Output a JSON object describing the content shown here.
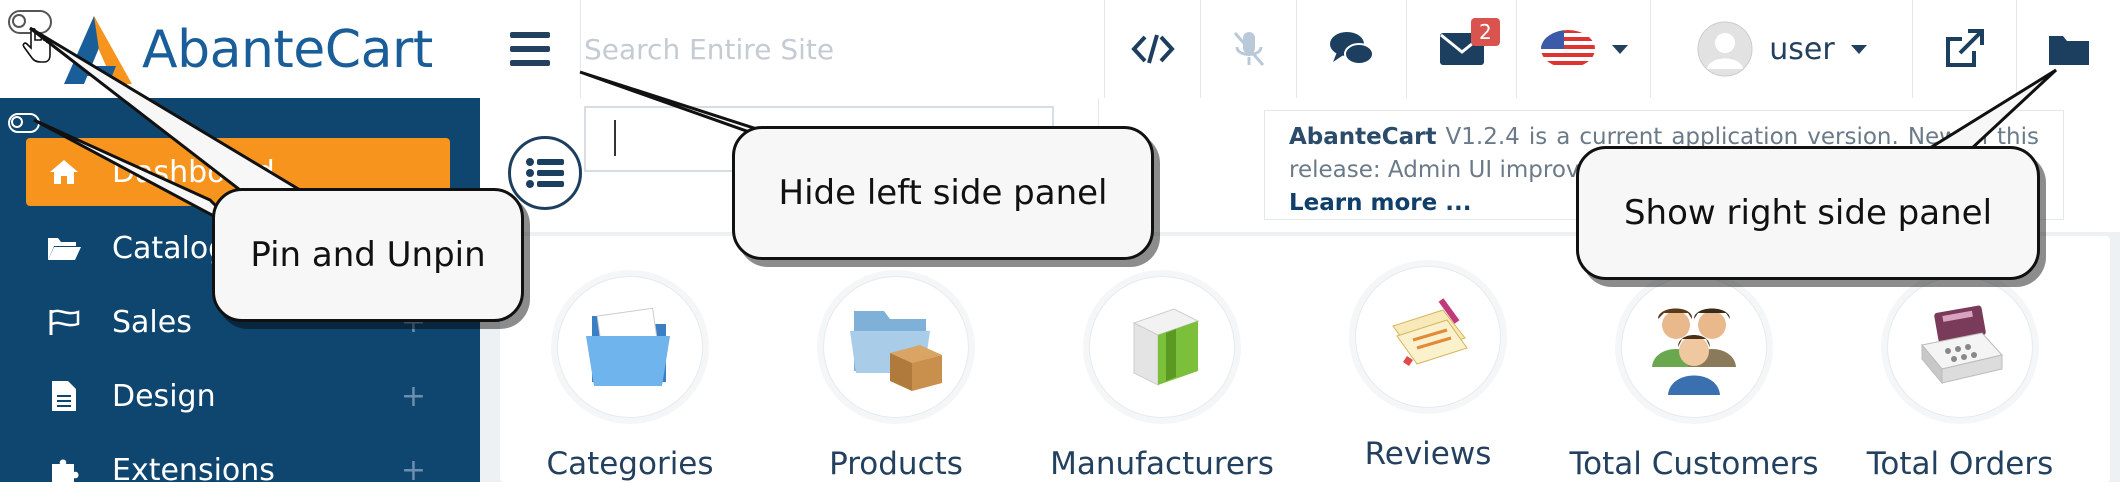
{
  "app": {
    "logo_text": "AbanteCart"
  },
  "header": {
    "search_placeholder": "Search Entire Site",
    "message_badge": "2",
    "user_name": "user"
  },
  "notice": {
    "brand": "AbanteCart",
    "text": " V1.2.4 is a current application version. New in this release: Admin UI improvements and system condition check",
    "link": "Learn more ..."
  },
  "sidebar": {
    "items": [
      {
        "label": "Dashboard",
        "icon": "home-icon",
        "active": true
      },
      {
        "label": "Catalog",
        "icon": "folder-open-icon"
      },
      {
        "label": "Sales",
        "icon": "flag-icon",
        "plus": "+"
      },
      {
        "label": "Design",
        "icon": "file-icon",
        "plus": "+"
      },
      {
        "label": "Extensions",
        "icon": "puzzle-icon",
        "plus": "+"
      }
    ]
  },
  "tiles": [
    {
      "label": "Categories",
      "icon": "folder-icon"
    },
    {
      "label": "Products",
      "icon": "box-icon"
    },
    {
      "label": "Manufacturers",
      "icon": "factory-icon"
    },
    {
      "label": "Reviews",
      "icon": "review-icon"
    },
    {
      "label": "Total Customers",
      "icon": "customers-icon"
    },
    {
      "label": "Total Orders",
      "icon": "cash-register-icon"
    }
  ],
  "callouts": {
    "pin": "Pin and Unpin",
    "hide_left": "Hide left side panel",
    "show_right": "Show right side panel"
  },
  "colors": {
    "brand_blue": "#1a5e99",
    "sidebar_bg": "#0f4670",
    "active_orange": "#f7941d",
    "badge_red": "#d9534f"
  }
}
